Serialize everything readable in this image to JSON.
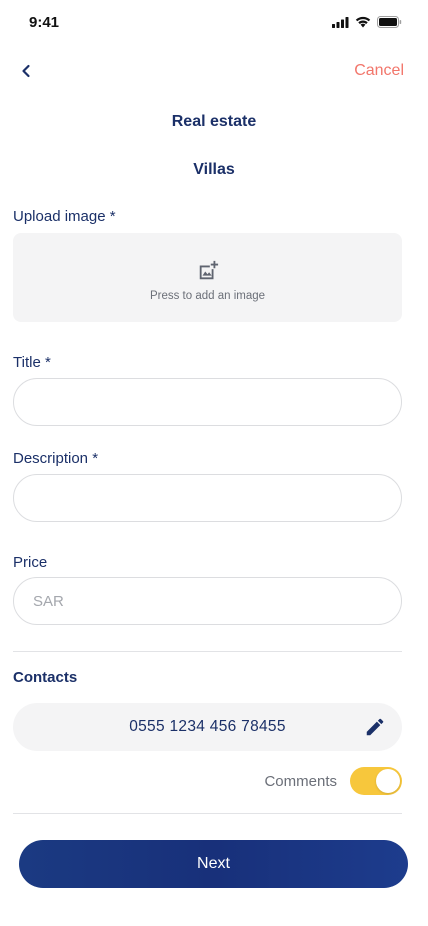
{
  "status_bar": {
    "time": "9:41"
  },
  "nav": {
    "back_icon": "chevron-left-icon",
    "cancel_label": "Cancel"
  },
  "header": {
    "category": "Real estate",
    "subcategory": "Villas"
  },
  "form": {
    "upload": {
      "label": "Upload image *",
      "hint": "Press to add an image",
      "icon": "add-photo-icon"
    },
    "title": {
      "label": "Title *",
      "value": "",
      "placeholder": ""
    },
    "description": {
      "label": "Description *",
      "value": "",
      "placeholder": ""
    },
    "price": {
      "label": "Price",
      "value": "",
      "placeholder": "SAR"
    }
  },
  "contacts": {
    "heading": "Contacts",
    "phone": "0555 1234 456 78455",
    "edit_icon": "pencil-icon"
  },
  "comments": {
    "label": "Comments",
    "enabled": true
  },
  "actions": {
    "next_label": "Next"
  },
  "colors": {
    "primary": "#1b3068",
    "cancel": "#f2766b",
    "toggle_on": "#f7c73c",
    "field_bg": "#f4f4f5"
  }
}
